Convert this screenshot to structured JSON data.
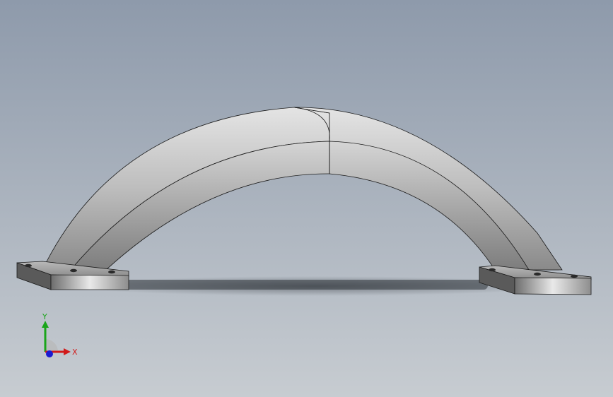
{
  "viewport": {
    "background_top": "#8e9aab",
    "background_bottom": "#c7ccd1",
    "model": {
      "name": "arch-handle",
      "body_color": "#9a9a9a",
      "edge_color": "#1a1a1a"
    }
  },
  "axis_triad": {
    "x_label": "X",
    "y_label": "Y",
    "x_color": "#d11a1a",
    "y_color": "#1aa51a",
    "z_color": "#1a1ad1"
  }
}
